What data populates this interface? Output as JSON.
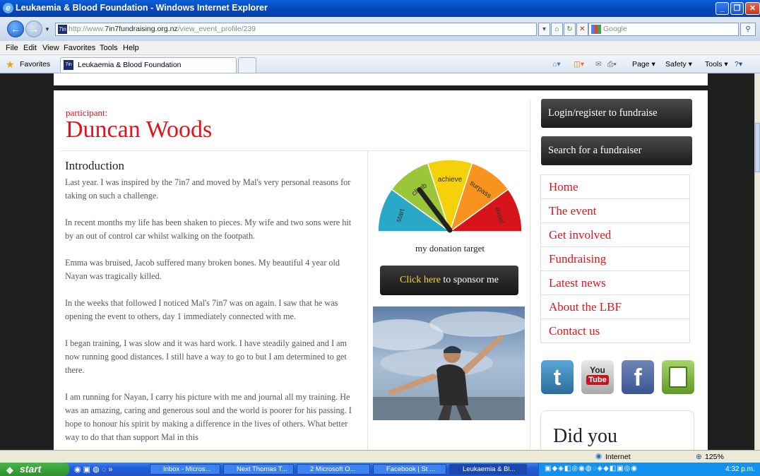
{
  "window": {
    "title": "Leukaemia & Blood Foundation - Windows Internet Explorer"
  },
  "address_bar": {
    "url_prefix": "http://www.",
    "url_domain": "7in7fundraising.org.nz",
    "url_path": "/view_event_profile/239",
    "search_placeholder": "Google"
  },
  "menu": [
    "File",
    "Edit",
    "View",
    "Favorites",
    "Tools",
    "Help"
  ],
  "favorites_bar": {
    "favorites_label": "Favorites",
    "tab_label": "Leukaemia & Blood Foundation",
    "commands": [
      "Page ▾",
      "Safety ▾",
      "Tools ▾"
    ]
  },
  "profile": {
    "kicker": "participant:",
    "name": "Duncan Woods",
    "intro_heading": "Introduction",
    "paragraphs": [
      "Last year. I was inspired by the 7in7 and moved by Mal's very personal reasons for taking on such a challenge.",
      "In recent months my life has been shaken to pieces. My wife and two sons were hit by an out of control car whilst walking on the footpath.",
      "Emma was bruised, Jacob suffered many broken bones. My beautiful 4 year old Nayan was tragically killed.",
      "In the weeks that followed I noticed Mal's 7in7 was on again. I saw that he was opening the event to others, day 1 immediately connected with me.",
      "I began training, I was slow and it was hard work. I have steadily gained and I am now running good distances. I still have a way to go to but I am determined to get there.",
      "I am running for Nayan, I carry his picture with me and journal all my training. He was an amazing, caring and generous soul and the world is poorer for his passing. I hope to honour his spirit by making a difference in the lives of others. What better way to do that than support Mal in this"
    ]
  },
  "gauge": {
    "segments": [
      "start",
      "climb",
      "achieve",
      "surpass",
      "excel"
    ],
    "colors": [
      "#2aa8c8",
      "#9cc63a",
      "#f5d10a",
      "#f7931e",
      "#d7141c"
    ],
    "caption": "my donation target",
    "needle_fraction": 0.3
  },
  "sponsor": {
    "link": "Click here",
    "rest": " to sponsor me"
  },
  "sidebar": {
    "login_button": "Login/register to fundraise",
    "search_button": "Search for a fundraiser",
    "nav": [
      "Home",
      "The event",
      "Get involved",
      "Fundraising",
      "Latest news",
      "About the LBF",
      "Contact us"
    ],
    "social": [
      "twitter-icon",
      "youtube-icon",
      "facebook-icon",
      "email-icon"
    ],
    "youtube_text": "You",
    "youtube_tube": "Tube",
    "did_you": "Did you"
  },
  "statusbar": {
    "zone": "Internet",
    "zoom": "125%"
  },
  "taskbar": {
    "start": "start",
    "tasks": [
      "Inbox - Micros...",
      "Next Thomas T...",
      "2 Microsoft O...",
      "Facebook | St ...",
      "Leukaemia & Bl..."
    ],
    "clock": "4:32 p.m."
  }
}
